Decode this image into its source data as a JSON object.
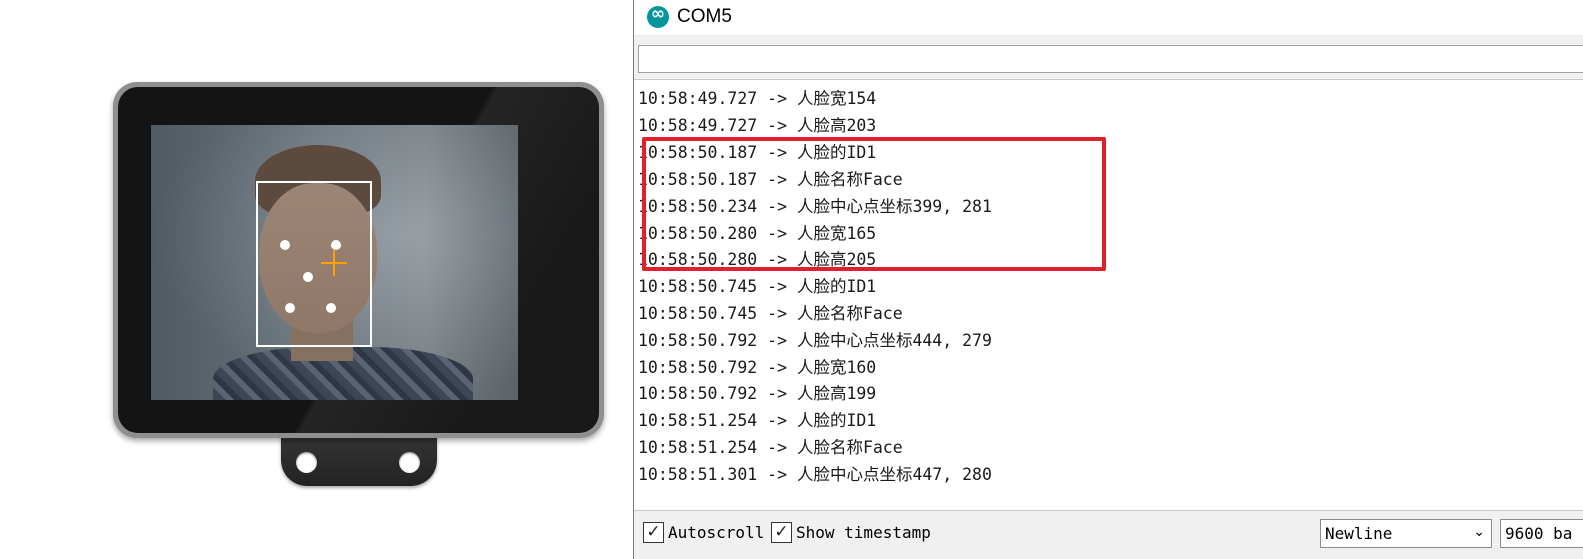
{
  "window": {
    "title": "COM5",
    "icon": "arduino-infinity-icon",
    "accent_color": "#00979c"
  },
  "send": {
    "value": "",
    "placeholder": ""
  },
  "output_lines": [
    "10:58:49.727 -> 人脸宽154",
    "10:58:49.727 -> 人脸高203",
    "10:58:50.187 -> 人脸的ID1",
    "10:58:50.187 -> 人脸名称Face",
    "10:58:50.234 -> 人脸中心点坐标399, 281",
    "10:58:50.280 -> 人脸宽165",
    "10:58:50.280 -> 人脸高205",
    "10:58:50.745 -> 人脸的ID1",
    "10:58:50.745 -> 人脸名称Face",
    "10:58:50.792 -> 人脸中心点坐标444, 279",
    "10:58:50.792 -> 人脸宽160",
    "10:58:50.792 -> 人脸高199",
    "10:58:51.254 -> 人脸的ID1",
    "10:58:51.254 -> 人脸名称Face",
    "10:58:51.301 -> 人脸中心点坐标447, 280"
  ],
  "highlight_color": "#e2202a",
  "footer": {
    "autoscroll": {
      "label": "Autoscroll",
      "checked": true
    },
    "timestamp": {
      "label": "Show timestamp",
      "checked": true
    },
    "line_ending": "Newline",
    "baud": "9600 ba"
  },
  "device": {
    "detection_box_color": "#ffffff",
    "crosshair_color": "#ff9f00"
  }
}
